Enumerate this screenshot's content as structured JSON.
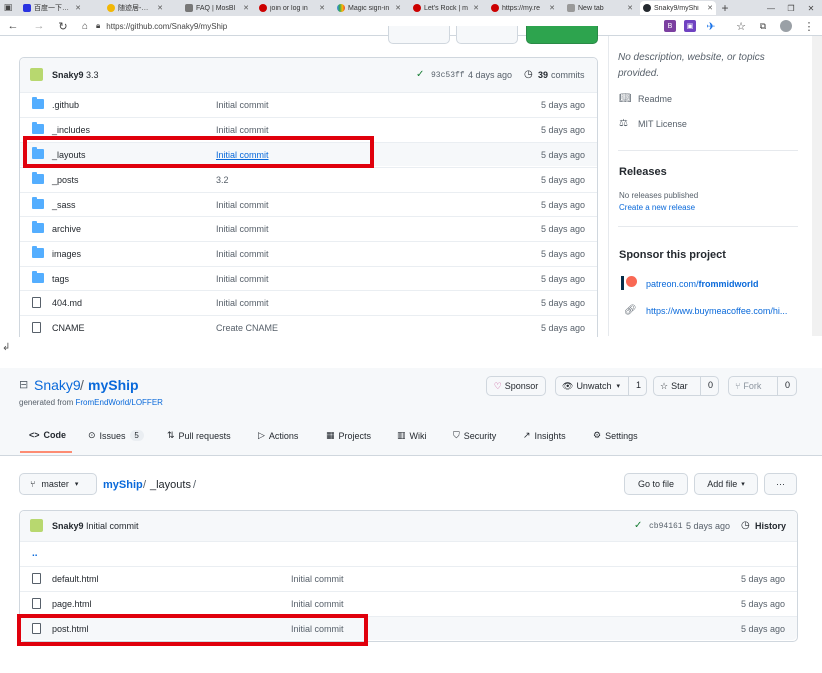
{
  "browser": {
    "tabs": [
      {
        "label": "百度一下，你"
      },
      {
        "label": "随迹居-防具"
      },
      {
        "label": "FAQ | MosBl"
      },
      {
        "label": "join or log in"
      },
      {
        "label": "Magic sign-in"
      },
      {
        "label": "Let's Rock | m"
      },
      {
        "label": "https://my.re"
      },
      {
        "label": "New tab"
      },
      {
        "label": "Snaky9/myShi"
      }
    ],
    "new_tab": "+",
    "url": "https://github.com/Snaky9/myShip"
  },
  "top": {
    "commit": {
      "author": "Snaky9",
      "message": "3.3",
      "sha": "93c53ff",
      "age": "4 days ago",
      "count": "39",
      "count_label": "commits"
    },
    "files": [
      {
        "name": ".github",
        "type": "dir",
        "message": "Initial commit",
        "age": "5 days ago"
      },
      {
        "name": "_includes",
        "type": "dir",
        "message": "Initial commit",
        "age": "5 days ago"
      },
      {
        "name": "_layouts",
        "type": "dir",
        "message": "Initial commit",
        "age": "5 days ago"
      },
      {
        "name": "_posts",
        "type": "dir",
        "message": "3.2",
        "age": "5 days ago"
      },
      {
        "name": "_sass",
        "type": "dir",
        "message": "Initial commit",
        "age": "5 days ago"
      },
      {
        "name": "archive",
        "type": "dir",
        "message": "Initial commit",
        "age": "5 days ago"
      },
      {
        "name": "images",
        "type": "dir",
        "message": "Initial commit",
        "age": "5 days ago"
      },
      {
        "name": "tags",
        "type": "dir",
        "message": "Initial commit",
        "age": "5 days ago"
      },
      {
        "name": "404.md",
        "type": "file",
        "message": "Initial commit",
        "age": "5 days ago"
      },
      {
        "name": "CNAME",
        "type": "file",
        "message": "Create CNAME",
        "age": "5 days ago"
      }
    ],
    "sidebar": {
      "about": "No description, website, or topics provided.",
      "readme": "Readme",
      "license": "MIT License",
      "releases_title": "Releases",
      "no_releases": "No releases published",
      "create_release": "Create a new release",
      "sponsor_title": "Sponsor this project",
      "patreon_prefix": "patreon.com/",
      "patreon_user": "frommidworld",
      "bmc": "https://www.buymeacoffee.com/hi..."
    }
  },
  "bottom": {
    "owner": "Snaky9",
    "slash": "/",
    "repo": "myShip",
    "generated_prefix": "generated from",
    "generated_from": "FromEndWorld/LOFFER",
    "sponsor": "Sponsor",
    "unwatch": "Unwatch",
    "unwatch_count": "1",
    "star": "Star",
    "star_count": "0",
    "fork": "Fork",
    "fork_count": "0",
    "tabs": [
      {
        "label": "Code"
      },
      {
        "label": "Issues",
        "count": "5"
      },
      {
        "label": "Pull requests"
      },
      {
        "label": "Actions"
      },
      {
        "label": "Projects"
      },
      {
        "label": "Wiki"
      },
      {
        "label": "Security"
      },
      {
        "label": "Insights"
      },
      {
        "label": "Settings"
      }
    ],
    "branch": "master",
    "path_repo": "myShip",
    "path_sep1": "/",
    "path_dir": "_layouts",
    "path_sep2": "/",
    "go_to_file": "Go to file",
    "add_file": "Add file",
    "more": "···",
    "commit": {
      "author": "Snaky9",
      "message": "Initial commit",
      "sha": "cb94161",
      "age": "5 days ago",
      "history": "History"
    },
    "parent": "..",
    "files": [
      {
        "name": "default.html",
        "message": "Initial commit",
        "age": "5 days ago"
      },
      {
        "name": "page.html",
        "message": "Initial commit",
        "age": "5 days ago"
      },
      {
        "name": "post.html",
        "message": "Initial commit",
        "age": "5 days ago"
      }
    ]
  },
  "colors": {
    "highlight": "#e0000c",
    "link": "#0969da",
    "folder": "#54aeff",
    "green": "#1a7f37"
  }
}
